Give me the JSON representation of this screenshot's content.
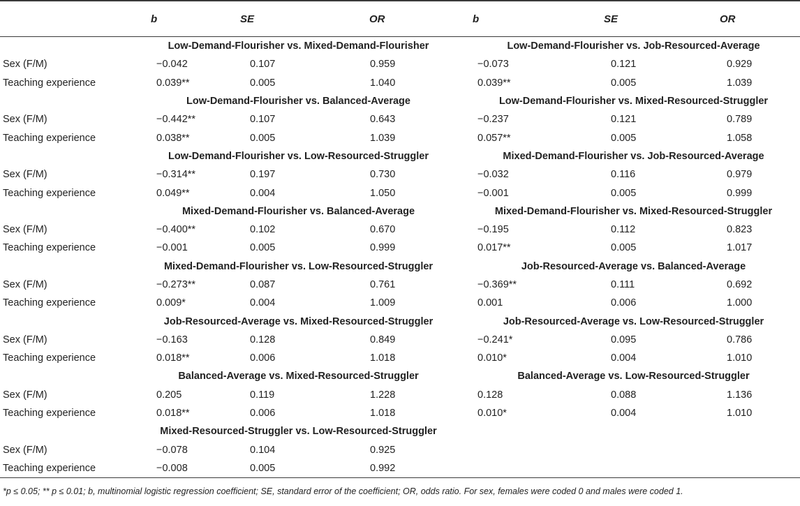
{
  "headers": {
    "b": "b",
    "se": "SE",
    "or": "OR"
  },
  "blocks": [
    {
      "left": {
        "title": "Low-Demand-Flourisher vs. Mixed-Demand-Flourisher",
        "rows": [
          {
            "b": "−0.042",
            "se": "0.107",
            "or": "0.959"
          },
          {
            "b": "0.039**",
            "se": "0.005",
            "or": "1.040"
          }
        ]
      },
      "right": {
        "title": "Low-Demand-Flourisher vs. Job-Resourced-Average",
        "rows": [
          {
            "b": "−0.073",
            "se": "0.121",
            "or": "0.929"
          },
          {
            "b": "0.039**",
            "se": "0.005",
            "or": "1.039"
          }
        ]
      }
    },
    {
      "left": {
        "title": "Low-Demand-Flourisher vs. Balanced-Average",
        "rows": [
          {
            "b": "−0.442**",
            "se": "0.107",
            "or": "0.643"
          },
          {
            "b": "0.038**",
            "se": "0.005",
            "or": "1.039"
          }
        ]
      },
      "right": {
        "title": "Low-Demand-Flourisher vs. Mixed-Resourced-Struggler",
        "rows": [
          {
            "b": "−0.237",
            "se": "0.121",
            "or": "0.789"
          },
          {
            "b": "0.057**",
            "se": "0.005",
            "or": "1.058"
          }
        ]
      }
    },
    {
      "left": {
        "title": "Low-Demand-Flourisher vs. Low-Resourced-Struggler",
        "rows": [
          {
            "b": "−0.314**",
            "se": "0.197",
            "or": "0.730"
          },
          {
            "b": "0.049**",
            "se": "0.004",
            "or": "1.050"
          }
        ]
      },
      "right": {
        "title": "Mixed-Demand-Flourisher vs. Job-Resourced-Average",
        "rows": [
          {
            "b": "−0.032",
            "se": "0.116",
            "or": "0.979"
          },
          {
            "b": "−0.001",
            "se": "0.005",
            "or": "0.999"
          }
        ]
      }
    },
    {
      "left": {
        "title": "Mixed-Demand-Flourisher vs. Balanced-Average",
        "rows": [
          {
            "b": "−0.400**",
            "se": "0.102",
            "or": "0.670"
          },
          {
            "b": "−0.001",
            "se": "0.005",
            "or": "0.999"
          }
        ]
      },
      "right": {
        "title": "Mixed-Demand-Flourisher vs. Mixed-Resourced-Struggler",
        "rows": [
          {
            "b": "−0.195",
            "se": "0.112",
            "or": "0.823"
          },
          {
            "b": "0.017**",
            "se": "0.005",
            "or": "1.017"
          }
        ]
      }
    },
    {
      "left": {
        "title": "Mixed-Demand-Flourisher vs. Low-Resourced-Struggler",
        "rows": [
          {
            "b": "−0.273**",
            "se": "0.087",
            "or": "0.761"
          },
          {
            "b": "0.009*",
            "se": "0.004",
            "or": "1.009"
          }
        ]
      },
      "right": {
        "title": "Job-Resourced-Average vs. Balanced-Average",
        "rows": [
          {
            "b": "−0.369**",
            "se": "0.111",
            "or": "0.692"
          },
          {
            "b": "0.001",
            "se": "0.006",
            "or": "1.000"
          }
        ]
      }
    },
    {
      "left": {
        "title": "Job-Resourced-Average vs. Mixed-Resourced-Struggler",
        "rows": [
          {
            "b": "−0.163",
            "se": "0.128",
            "or": "0.849"
          },
          {
            "b": "0.018**",
            "se": "0.006",
            "or": "1.018"
          }
        ]
      },
      "right": {
        "title": "Job-Resourced-Average vs. Low-Resourced-Struggler",
        "rows": [
          {
            "b": "−0.241*",
            "se": "0.095",
            "or": "0.786"
          },
          {
            "b": "0.010*",
            "se": "0.004",
            "or": "1.010"
          }
        ]
      }
    },
    {
      "left": {
        "title": "Balanced-Average vs. Mixed-Resourced-Struggler",
        "rows": [
          {
            "b": "0.205",
            "se": "0.119",
            "or": "1.228"
          },
          {
            "b": "0.018**",
            "se": "0.006",
            "or": "1.018"
          }
        ]
      },
      "right": {
        "title": "Balanced-Average vs. Low-Resourced-Struggler",
        "rows": [
          {
            "b": "0.128",
            "se": "0.088",
            "or": "1.136"
          },
          {
            "b": "0.010*",
            "se": "0.004",
            "or": "1.010"
          }
        ]
      }
    },
    {
      "left": {
        "title": "Mixed-Resourced-Struggler vs. Low-Resourced-Struggler",
        "rows": [
          {
            "b": "−0.078",
            "se": "0.104",
            "or": "0.925"
          },
          {
            "b": "−0.008",
            "se": "0.005",
            "or": "0.992"
          }
        ]
      },
      "right": null
    }
  ],
  "row_labels": [
    "Sex (F/M)",
    "Teaching experience"
  ],
  "footnote": "*p ≤ 0.05; ** p ≤ 0.01; b, multinomial logistic regression coefficient; SE, standard error of the coefficient; OR, odds ratio. For sex, females were coded 0 and males were coded 1."
}
